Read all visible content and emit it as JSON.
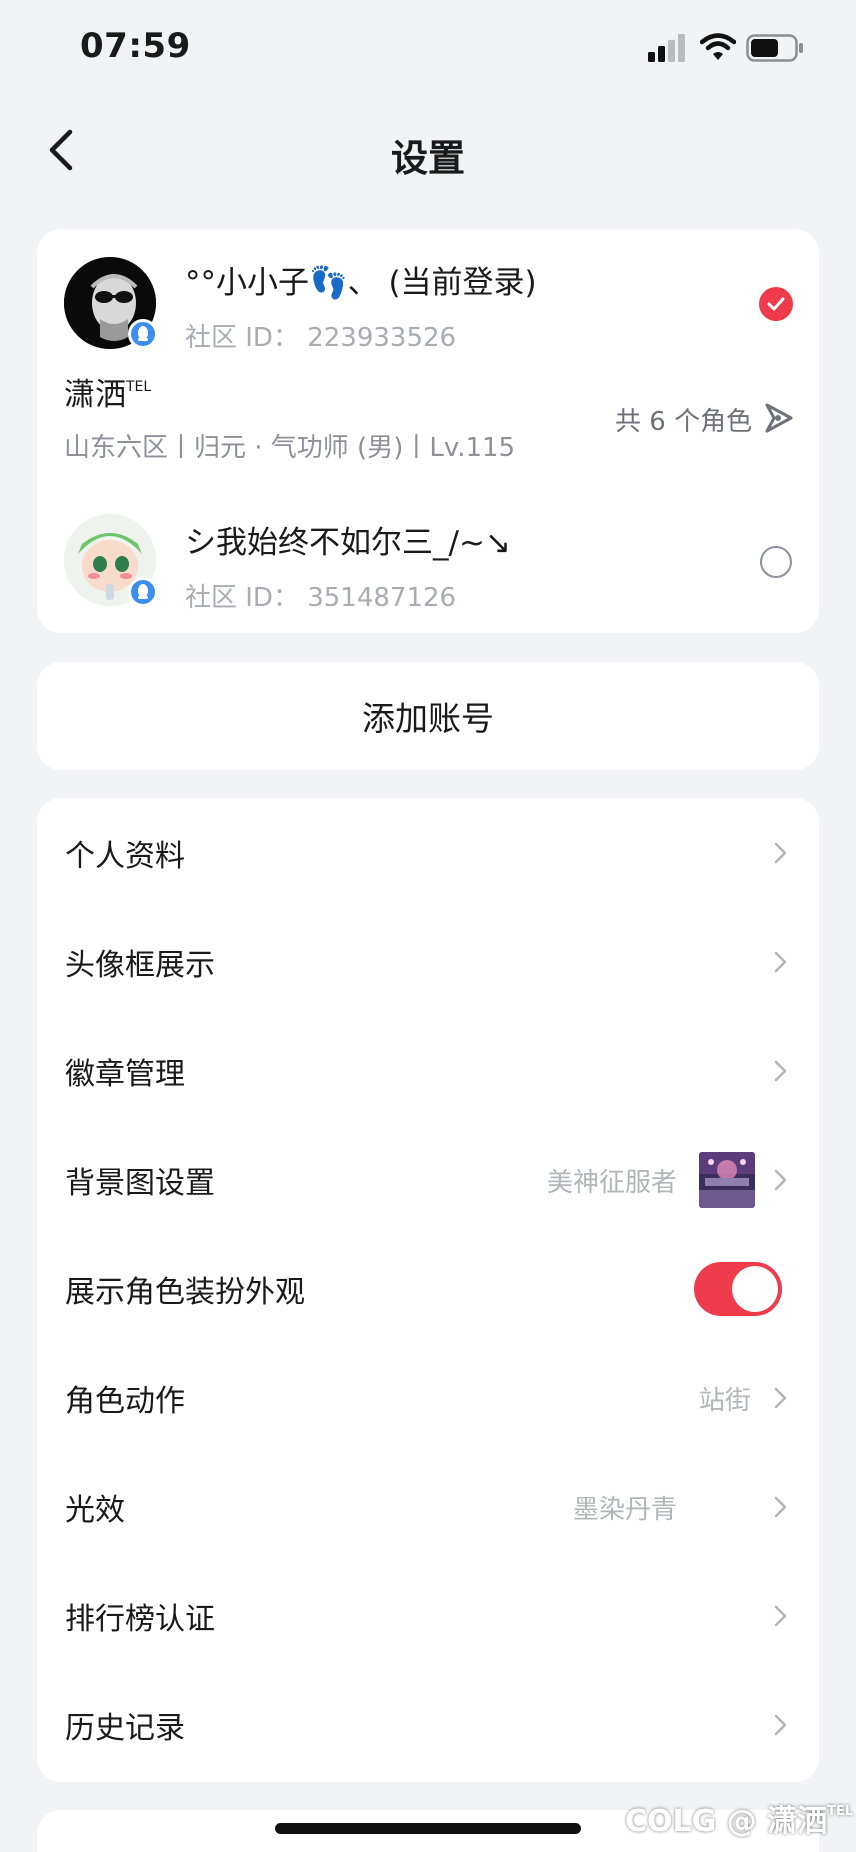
{
  "status_bar": {
    "time": "07:59"
  },
  "nav": {
    "title": "设置"
  },
  "accounts": [
    {
      "name": "°°小小子👣、 (当前登录)",
      "community_id": "社区 ID： 223933526",
      "selected": true,
      "role": {
        "name": "潇洒",
        "name_sup": "TEL",
        "info": "山东六区丨归元 · 气功师 (男)丨Lv.115",
        "count": "共 6 个角色"
      }
    },
    {
      "name": "シ我始终不如尔三_/~↘",
      "community_id": "社区 ID： 351487126",
      "selected": false
    }
  ],
  "add_account": {
    "label": "添加账号"
  },
  "settings": {
    "items": [
      {
        "label": "个人资料"
      },
      {
        "label": "头像框展示"
      },
      {
        "label": "徽章管理"
      },
      {
        "label": "背景图设置",
        "value": "美神征服者"
      },
      {
        "label": "展示角色装扮外观",
        "toggle_on": true
      },
      {
        "label": "角色动作",
        "value": "站街"
      },
      {
        "label": "光效",
        "value": "墨染丹青"
      },
      {
        "label": "排行榜认证"
      },
      {
        "label": "历史记录"
      }
    ]
  },
  "watermark": {
    "text": "COLG @ 潇洒",
    "sup": "TEL"
  },
  "colors": {
    "accent": "#ef3b4c",
    "badge": "#3d8ef0",
    "background": "#f2f3f6"
  }
}
